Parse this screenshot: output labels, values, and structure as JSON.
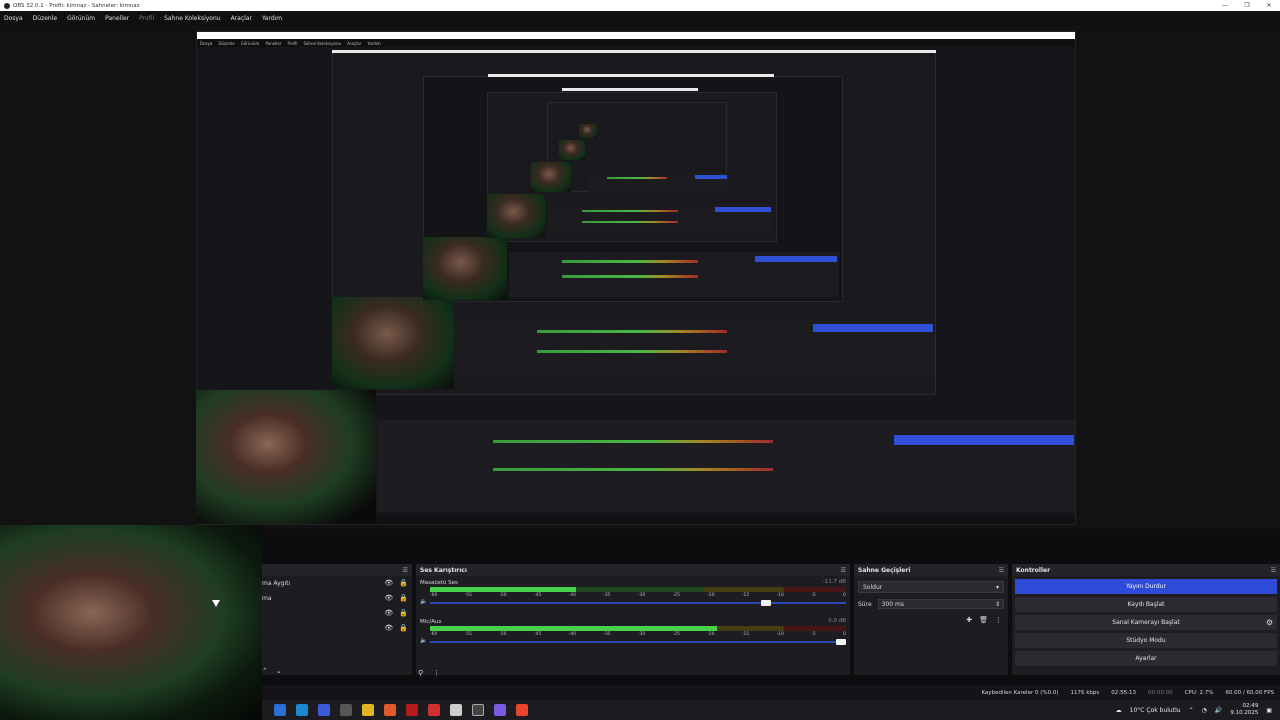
{
  "window": {
    "title": "OBS 32.0.1 - Profil: kimnaz - Sahneler: kimnaz",
    "controls": [
      "—",
      "❐",
      "✕"
    ]
  },
  "menu": [
    "Dosya",
    "Düzenle",
    "Görünüm",
    "Paneller",
    "Profil",
    "Sahne Koleksiyonu",
    "Araçlar",
    "Yardım"
  ],
  "scenes": {
    "items": [
      "ma Aygıtı",
      "ma"
    ]
  },
  "mixer": {
    "title": "Ses Karıştırıcı",
    "channels": [
      {
        "name": "Masaüstü Ses",
        "db": "-11.7 dB",
        "level": 0.35,
        "volume": 0.82
      },
      {
        "name": "Mic/Aux",
        "db": "0.0 dB",
        "level": 0.69,
        "volume": 1.0
      }
    ],
    "scale": [
      "-60",
      "-55",
      "-50",
      "-45",
      "-40",
      "-35",
      "-30",
      "-25",
      "-20",
      "-15",
      "-10",
      "-5",
      "0"
    ]
  },
  "transitions": {
    "title": "Sahne Geçişleri",
    "selected": "Soldur",
    "duration_label": "Süre",
    "duration_value": "300 ms"
  },
  "controls": {
    "title": "Kontroller",
    "stop_stream": "Yayını Durdur",
    "start_record": "Kaydı Başlat",
    "virtual_cam": "Sanal Kamerayı Başlat",
    "studio_mode": "Stüdyo Modu",
    "settings": "Ayarlar"
  },
  "status": {
    "dropped": "Kaybedilen Kareler 0 (%0.0)",
    "bitrate": "1176 kbps",
    "live_time": "02:55:13",
    "rec_time": "00:00:00",
    "cpu": "CPU: 2.7%",
    "fps": "60.00 / 60.00 FPS"
  },
  "taskbar": {
    "weather": "10°C  Çok bulutlu",
    "time": "02:49",
    "date": "9.10.2025"
  },
  "colors": {
    "accent": "#2d4ad9",
    "meter_green": "#49b849",
    "meter_yellow": "#a38822",
    "meter_red": "#a32a2a"
  }
}
